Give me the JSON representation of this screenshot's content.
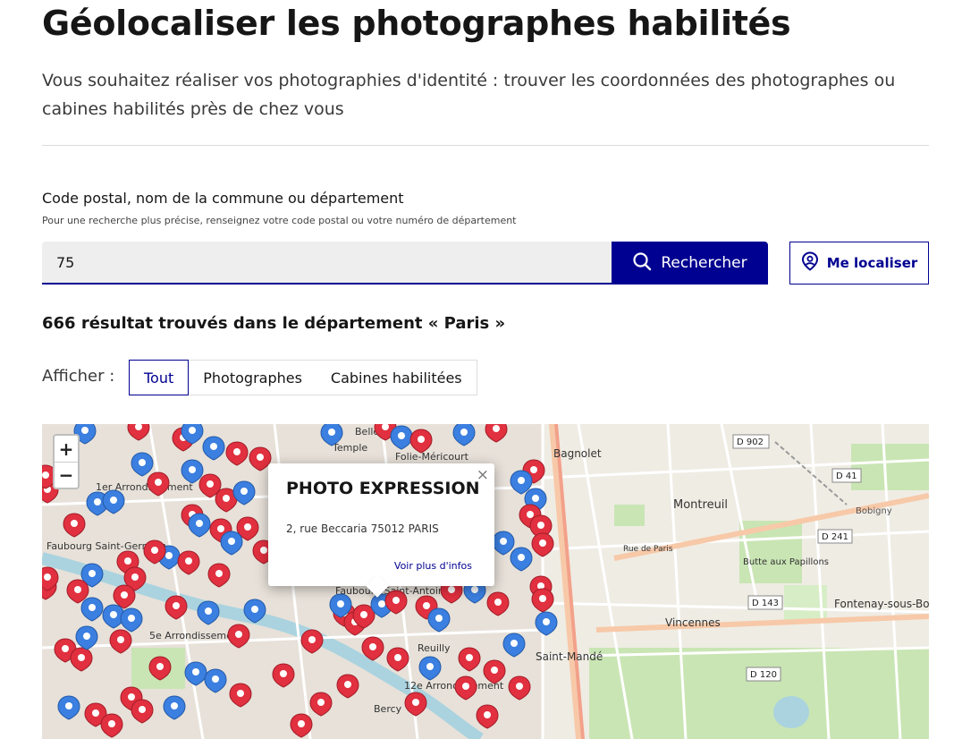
{
  "header": {
    "title": "Géolocaliser les photographes habilités",
    "lead": "Vous souhaitez réaliser vos photographies d'identité : trouver les coordonnées des photographes ou cabines habilités près de chez vous"
  },
  "search": {
    "label": "Code postal, nom de la commune ou département",
    "hint": "Pour une recherche plus précise, renseignez votre code postal ou votre numéro de département",
    "value": "75",
    "submit_label": "Rechercher",
    "locate_label": "Me localiser"
  },
  "results": {
    "summary": "666 résultat trouvés dans le département « Paris »"
  },
  "filter": {
    "label": "Afficher :",
    "options": [
      "Tout",
      "Photographes",
      "Cabines habilitées"
    ],
    "selected": "Tout"
  },
  "map": {
    "zoom_in": "+",
    "zoom_out": "−",
    "labels": {
      "bagnolet": "Bagnolet",
      "montreuil": "Montreuil",
      "vincennes": "Vincennes",
      "saint_mande": "Saint-Mandé",
      "fontenay": "Fontenay-sous-Bois",
      "butte": "Butte aux Papillons",
      "faubourg_st_germain": "Faubourg Saint-Germain",
      "arr1": "1er Arrondissement",
      "arr5": "5e Arrondissement",
      "arr12": "12e Arrondissement",
      "faubourg_st_antoine": "Faubourg Saint-Antoine",
      "reuilly": "Reuilly",
      "bercy": "Bercy",
      "belleville": "Belleville",
      "temple": "Temple",
      "folie_mericourt": "Folie-Méricourt",
      "d902": "D 902",
      "d41": "D 41",
      "d241": "D 241",
      "d143": "D 143",
      "d120": "D 120",
      "bobigny": "Bobigny",
      "rue_de_paris": "Rue de Paris"
    },
    "popup": {
      "close": "×",
      "title": "PHOTO EXPRESSION",
      "address": "2, rue Beccaria 75012 PARIS",
      "link": "Voir plus d'infos"
    },
    "colors": {
      "photographer_marker": "#e1303f",
      "cabin_marker": "#3b7fe0",
      "park": "#c9e5b4",
      "road": "#ffffff",
      "major_road": "#f7c9a8"
    }
  }
}
